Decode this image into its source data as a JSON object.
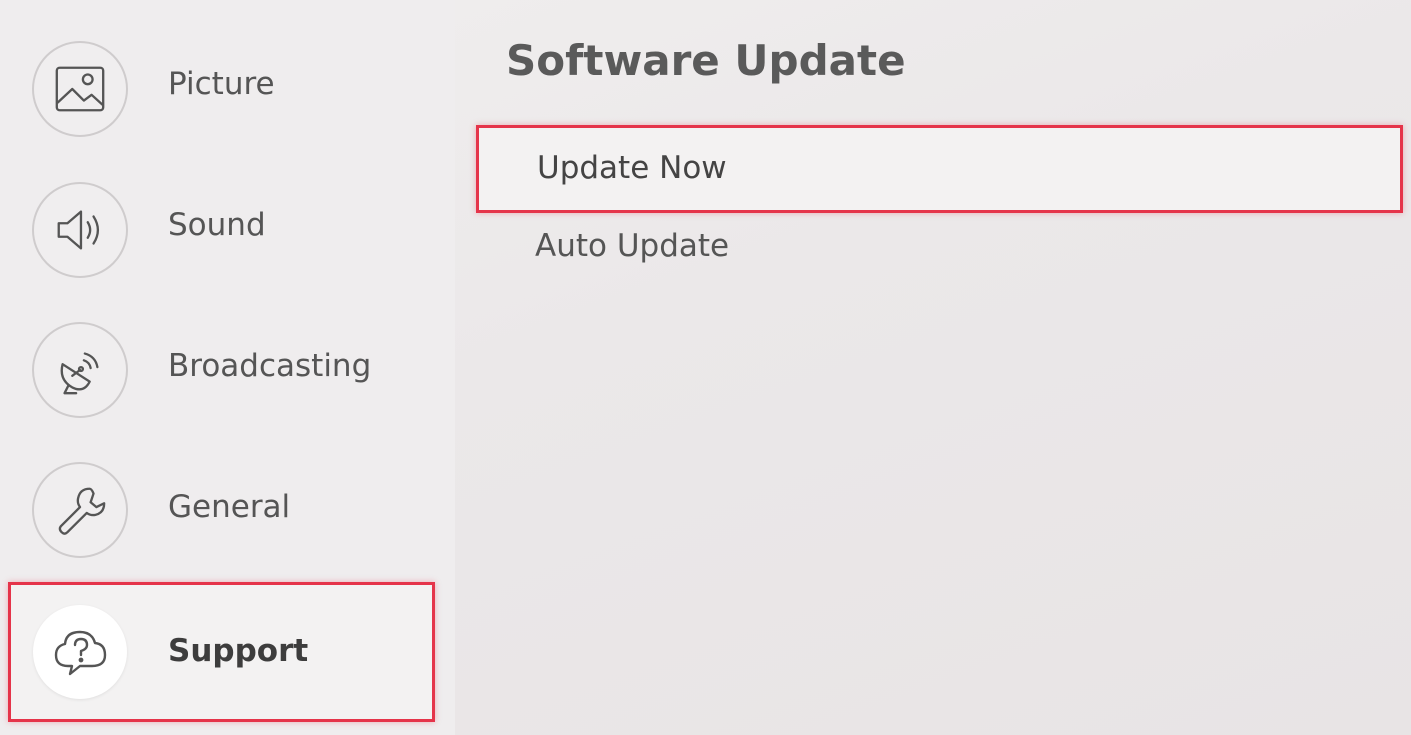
{
  "sidebar": {
    "items": [
      {
        "label": "Picture",
        "icon": "picture-icon"
      },
      {
        "label": "Sound",
        "icon": "speaker-icon"
      },
      {
        "label": "Broadcasting",
        "icon": "satellite-dish-icon"
      },
      {
        "label": "General",
        "icon": "wrench-icon"
      },
      {
        "label": "Support",
        "icon": "help-cloud-icon",
        "selected": true
      }
    ]
  },
  "panel": {
    "title": "Software Update",
    "options": [
      {
        "label": "Update Now",
        "focused": true
      },
      {
        "label": "Auto Update"
      }
    ]
  },
  "colors": {
    "focus_border": "#e5344a",
    "background": "#ece9ea",
    "text": "#555555"
  }
}
